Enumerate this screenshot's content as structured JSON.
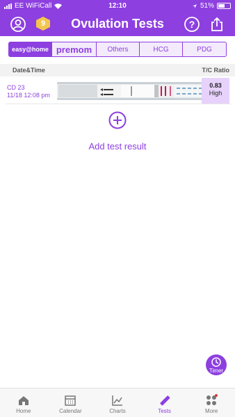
{
  "status_bar": {
    "carrier": "EE WiFiCall",
    "time": "12:10",
    "battery": "51%"
  },
  "header": {
    "title": "Ovulation Tests",
    "badge": "9"
  },
  "brands": [
    {
      "label": "easy@home",
      "selected": true
    },
    {
      "label": "premom",
      "selected": false
    },
    {
      "label": "Others",
      "selected": false
    },
    {
      "label": "HCG",
      "selected": false
    },
    {
      "label": "PDG",
      "selected": false
    }
  ],
  "table": {
    "col_left": "Date&Time",
    "col_right": "T/C Ratio",
    "rows": [
      {
        "cycle_day": "CD 23",
        "datetime": "11/18 12:08 pm",
        "ratio": "0.83",
        "level": "High"
      }
    ]
  },
  "add_label": "Add test result",
  "timer_label": "Timer",
  "tabs": [
    {
      "label": "Home",
      "icon": "home-icon"
    },
    {
      "label": "Calendar",
      "icon": "calendar-icon"
    },
    {
      "label": "Charts",
      "icon": "charts-icon"
    },
    {
      "label": "Tests",
      "icon": "tests-icon",
      "active": true
    },
    {
      "label": "More",
      "icon": "more-icon"
    }
  ],
  "colors": {
    "accent": "#8d3fe0",
    "ratio_bg": "#e7d2fb"
  }
}
